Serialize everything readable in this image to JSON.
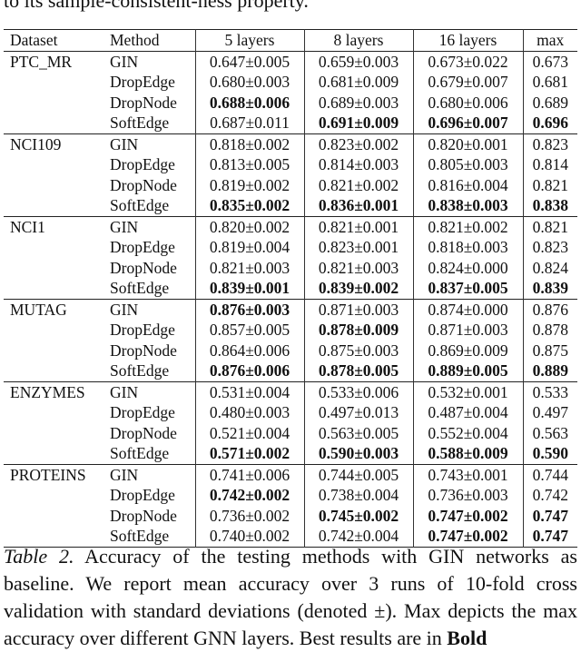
{
  "top_text": "to its sample-consistent-ness property.",
  "table": {
    "headers": [
      "Dataset",
      "Method",
      "5 layers",
      "8 layers",
      "16 layers",
      "max"
    ],
    "groups": [
      {
        "dataset": "PTC_MR",
        "rows": [
          {
            "method": "GIN",
            "l5": "0.647±0.005",
            "l8": "0.659±0.003",
            "l16": "0.673±0.022",
            "max": "0.673",
            "bold": []
          },
          {
            "method": "DropEdge",
            "l5": "0.680±0.003",
            "l8": "0.681±0.009",
            "l16": "0.679±0.007",
            "max": "0.681",
            "bold": []
          },
          {
            "method": "DropNode",
            "l5": "0.688±0.006",
            "l8": "0.689±0.003",
            "l16": "0.680±0.006",
            "max": "0.689",
            "bold": [
              "l5"
            ]
          },
          {
            "method": "SoftEdge",
            "l5": "0.687±0.011",
            "l8": "0.691±0.009",
            "l16": "0.696±0.007",
            "max": "0.696",
            "bold": [
              "l8",
              "l16",
              "max"
            ]
          }
        ]
      },
      {
        "dataset": "NCI109",
        "rows": [
          {
            "method": "GIN",
            "l5": "0.818±0.002",
            "l8": "0.823±0.002",
            "l16": "0.820±0.001",
            "max": "0.823",
            "bold": []
          },
          {
            "method": "DropEdge",
            "l5": "0.813±0.005",
            "l8": "0.814±0.003",
            "l16": "0.805±0.003",
            "max": "0.814",
            "bold": []
          },
          {
            "method": "DropNode",
            "l5": "0.819±0.002",
            "l8": "0.821±0.002",
            "l16": "0.816±0.004",
            "max": "0.821",
            "bold": []
          },
          {
            "method": "SoftEdge",
            "l5": "0.835±0.002",
            "l8": "0.836±0.001",
            "l16": "0.838±0.003",
            "max": "0.838",
            "bold": [
              "l5",
              "l8",
              "l16",
              "max"
            ]
          }
        ]
      },
      {
        "dataset": "NCI1",
        "rows": [
          {
            "method": "GIN",
            "l5": "0.820±0.002",
            "l8": "0.821±0.001",
            "l16": "0.821±0.002",
            "max": "0.821",
            "bold": []
          },
          {
            "method": "DropEdge",
            "l5": "0.819±0.004",
            "l8": "0.823±0.001",
            "l16": "0.818±0.003",
            "max": "0.823",
            "bold": []
          },
          {
            "method": "DropNode",
            "l5": "0.821±0.003",
            "l8": "0.821±0.003",
            "l16": "0.824±0.000",
            "max": "0.824",
            "bold": []
          },
          {
            "method": "SoftEdge",
            "l5": "0.839±0.001",
            "l8": "0.839±0.002",
            "l16": "0.837±0.005",
            "max": "0.839",
            "bold": [
              "l5",
              "l8",
              "l16",
              "max"
            ]
          }
        ]
      },
      {
        "dataset": "MUTAG",
        "rows": [
          {
            "method": "GIN",
            "l5": "0.876±0.003",
            "l8": "0.871±0.003",
            "l16": "0.874±0.000",
            "max": "0.876",
            "bold": [
              "l5"
            ]
          },
          {
            "method": "DropEdge",
            "l5": "0.857±0.005",
            "l8": "0.878±0.009",
            "l16": "0.871±0.003",
            "max": "0.878",
            "bold": [
              "l8"
            ]
          },
          {
            "method": "DropNode",
            "l5": "0.864±0.006",
            "l8": "0.875±0.003",
            "l16": "0.869±0.009",
            "max": "0.875",
            "bold": []
          },
          {
            "method": "SoftEdge",
            "l5": "0.876±0.006",
            "l8": "0.878±0.005",
            "l16": "0.889±0.005",
            "max": "0.889",
            "bold": [
              "l5",
              "l8",
              "l16",
              "max"
            ]
          }
        ]
      },
      {
        "dataset": "ENZYMES",
        "rows": [
          {
            "method": "GIN",
            "l5": "0.531±0.004",
            "l8": "0.533±0.006",
            "l16": "0.532±0.001",
            "max": "0.533",
            "bold": []
          },
          {
            "method": "DropEdge",
            "l5": "0.480±0.003",
            "l8": "0.497±0.013",
            "l16": "0.487±0.004",
            "max": "0.497",
            "bold": []
          },
          {
            "method": "DropNode",
            "l5": "0.521±0.004",
            "l8": "0.563±0.005",
            "l16": "0.552±0.004",
            "max": "0.563",
            "bold": []
          },
          {
            "method": "SoftEdge",
            "l5": "0.571±0.002",
            "l8": "0.590±0.003",
            "l16": "0.588±0.009",
            "max": "0.590",
            "bold": [
              "l5",
              "l8",
              "l16",
              "max"
            ]
          }
        ]
      },
      {
        "dataset": "PROTEINS",
        "rows": [
          {
            "method": "GIN",
            "l5": "0.741±0.006",
            "l8": "0.744±0.005",
            "l16": "0.743±0.001",
            "max": "0.744",
            "bold": []
          },
          {
            "method": "DropEdge",
            "l5": "0.742±0.002",
            "l8": "0.738±0.004",
            "l16": "0.736±0.003",
            "max": "0.742",
            "bold": [
              "l5"
            ]
          },
          {
            "method": "DropNode",
            "l5": "0.736±0.002",
            "l8": "0.745±0.002",
            "l16": "0.747±0.002",
            "max": "0.747",
            "bold": [
              "l8",
              "l16",
              "max"
            ]
          },
          {
            "method": "SoftEdge",
            "l5": "0.740±0.002",
            "l8": "0.742±0.004",
            "l16": "0.747±0.002",
            "max": "0.747",
            "bold": [
              "l16",
              "max"
            ]
          }
        ]
      }
    ]
  },
  "caption": {
    "label": "Table 2.",
    "text": " Accuracy of the testing methods with GIN networks as baseline. We report mean accuracy over 3 runs of 10-fold cross validation with standard deviations (denoted ±). Max depicts the max accuracy over different GNN layers. Best results are in ",
    "bold_tail": "Bold"
  }
}
